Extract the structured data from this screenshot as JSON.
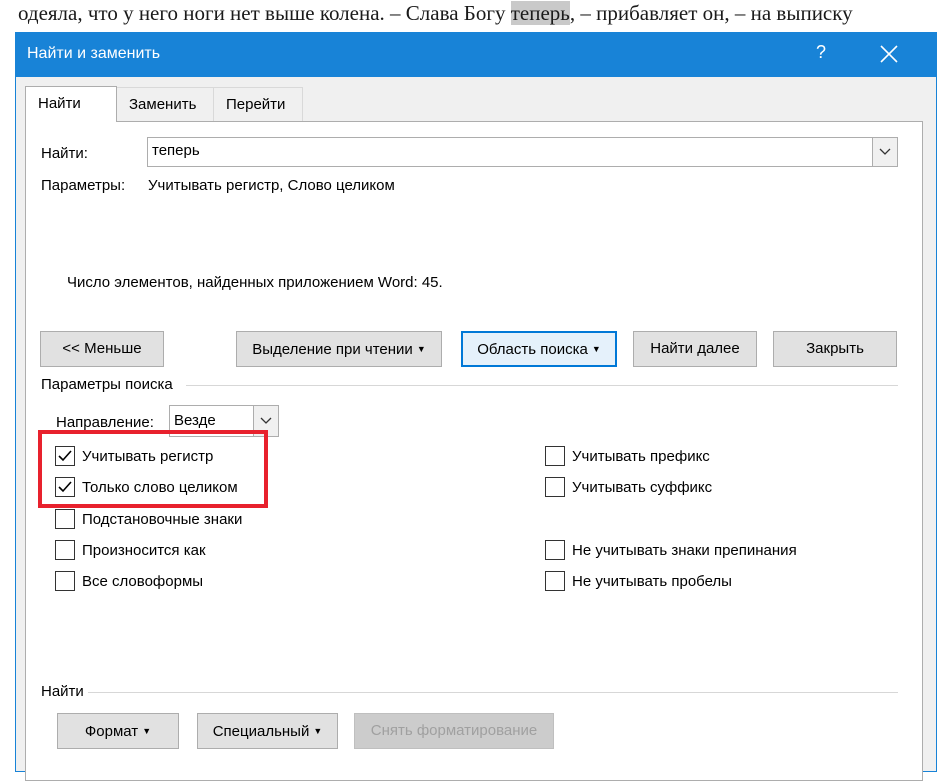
{
  "document": {
    "text_before": "одеяла, что у него ноги нет выше колена. – Слава Богу ",
    "highlighted": "теперь",
    "text_after": ", – прибавляет он, – на выписку"
  },
  "dialog": {
    "title": "Найти и заменить",
    "help_label": "?",
    "close_icon": "close-icon"
  },
  "tabs": [
    {
      "label": "Найти",
      "active": true
    },
    {
      "label": "Заменить",
      "active": false
    },
    {
      "label": "Перейти",
      "active": false
    }
  ],
  "find": {
    "label": "Найти:",
    "value": "теперь",
    "params_label": "Параметры:",
    "params_value": "Учитывать регистр, Слово целиком",
    "result": "Число элементов, найденных приложением Word: 45."
  },
  "buttons": {
    "less": "<< Меньше",
    "reading_highlight": "Выделение при чтении",
    "find_in": "Область поиска",
    "find_next": "Найти далее",
    "close": "Закрыть"
  },
  "search_options": {
    "section_label": "Параметры поиска",
    "direction_label": "Направление:",
    "direction_value": "Везде",
    "left": [
      {
        "label": "Учитывать регистр",
        "checked": true
      },
      {
        "label": "Только слово целиком",
        "checked": true
      },
      {
        "label": "Подстановочные знаки",
        "checked": false
      },
      {
        "label": "Произносится как",
        "checked": false
      },
      {
        "label": "Все словоформы",
        "checked": false
      }
    ],
    "right": [
      {
        "label": "Учитывать префикс",
        "checked": false
      },
      {
        "label": "Учитывать суффикс",
        "checked": false
      },
      {
        "label": "Не учитывать знаки препинания",
        "checked": false
      },
      {
        "label": "Не учитывать пробелы",
        "checked": false
      }
    ]
  },
  "find_section": {
    "label": "Найти",
    "format": "Формат",
    "special": "Специальный",
    "no_formatting": "Снять форматирование"
  },
  "colors": {
    "accent": "#1883d7",
    "highlight_box": "#e8212d"
  }
}
